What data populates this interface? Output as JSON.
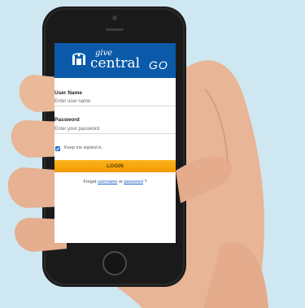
{
  "app": {
    "brand_give": "give",
    "brand_central": "central",
    "brand_go": "GO"
  },
  "login_form": {
    "username_label": "User Name",
    "username_placeholder": "Enter user name",
    "password_label": "Password",
    "password_placeholder": "Enter your password",
    "remember_label": "Keep me signed in.",
    "remember_checked": true,
    "login_button_label": "LOGIN",
    "forgot_prefix": "Forgot",
    "forgot_username_link": "username",
    "forgot_or": "or",
    "forgot_password_link": "password",
    "forgot_suffix": "?"
  },
  "colors": {
    "background": "#cfe7f1",
    "header_blue": "#0a5aa9",
    "button_orange": "#f7a50c",
    "checkbox_blue": "#1e6fcf",
    "link_blue": "#1f5fc8",
    "skin": "#e8b597",
    "phone_body": "#1a1a1a"
  },
  "icons": [
    "hand-illustration",
    "smartphone",
    "give-central-logo-icon",
    "checkmark-icon"
  ]
}
